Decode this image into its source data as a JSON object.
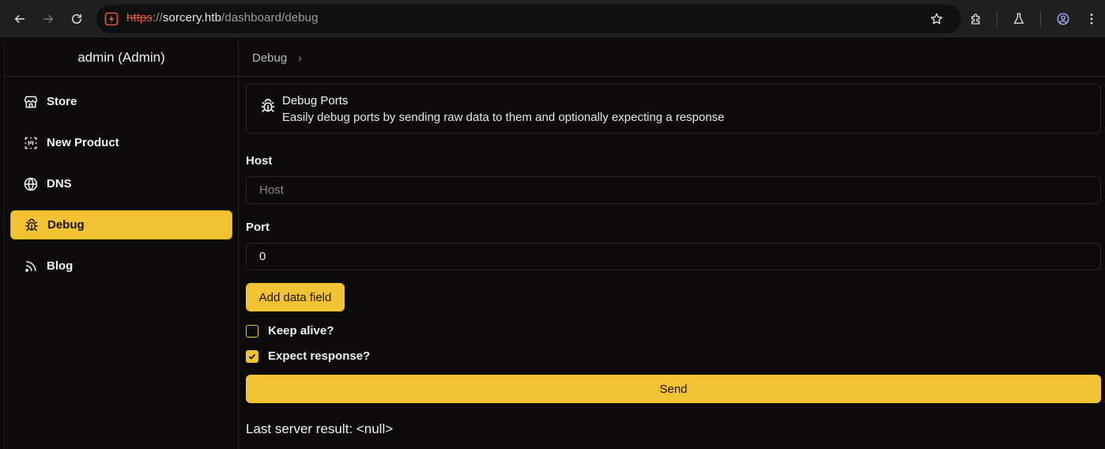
{
  "browser": {
    "url_scheme": "https",
    "url_sep": "://",
    "url_host": "sorcery.htb",
    "url_path": "/dashboard/debug",
    "icons": [
      "back-icon",
      "forward-icon",
      "reload-icon",
      "not-secure-icon",
      "bookmark-star-icon",
      "extensions-icon",
      "labs-flask-icon",
      "profile-icon",
      "menu-kebab-icon"
    ]
  },
  "sidebar": {
    "user": "admin (Admin)",
    "items": [
      {
        "label": "Store",
        "icon": "store-icon"
      },
      {
        "label": "New Product",
        "icon": "new-product-icon"
      },
      {
        "label": "DNS",
        "icon": "globe-icon"
      },
      {
        "label": "Debug",
        "icon": "bug-icon",
        "active": true
      },
      {
        "label": "Blog",
        "icon": "rss-icon"
      }
    ]
  },
  "breadcrumb": {
    "current": "Debug",
    "chevron": "›"
  },
  "alert": {
    "title": "Debug Ports",
    "description": "Easily debug ports by sending raw data to them and optionally expecting a response"
  },
  "form": {
    "host_label": "Host",
    "host_placeholder": "Host",
    "host_value": "",
    "port_label": "Port",
    "port_value": "0",
    "add_data_label": "Add data field",
    "keep_alive_label": "Keep alive?",
    "keep_alive_checked": false,
    "expect_response_label": "Expect response?",
    "expect_response_checked": true,
    "send_label": "Send"
  },
  "result": {
    "text": "Last server result: <null>"
  },
  "colors": {
    "accent": "#f1c232",
    "background": "#0c0b0a",
    "border": "#262626",
    "chrome": "#1f1f1f"
  }
}
